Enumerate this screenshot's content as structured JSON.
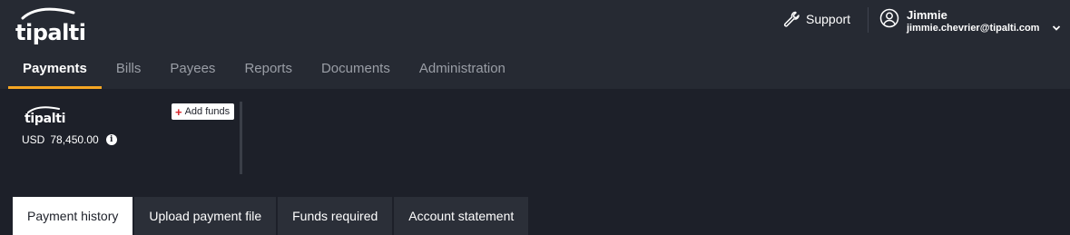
{
  "brand": {
    "logo_text": "tipalti",
    "accent_color": "#f5a623",
    "plus_color": "#d9262c"
  },
  "header": {
    "support_label": "Support",
    "support_icon": "wrench-icon",
    "user": {
      "name": "Jimmie",
      "email": "jimmie.chevrier@tipalti.com",
      "avatar_icon": "user-circle-icon",
      "menu_icon": "chevron-down-icon"
    }
  },
  "nav": {
    "items": [
      {
        "label": "Payments",
        "active": true
      },
      {
        "label": "Bills"
      },
      {
        "label": "Payees"
      },
      {
        "label": "Reports"
      },
      {
        "label": "Documents"
      },
      {
        "label": "Administration"
      }
    ]
  },
  "balance": {
    "account_logo": "tipalti",
    "currency": "USD",
    "amount": "78,450.00",
    "info_icon": "info-icon",
    "add_funds_label": "Add funds"
  },
  "tabs": [
    {
      "label": "Payment history",
      "active": true
    },
    {
      "label": "Upload payment file"
    },
    {
      "label": "Funds required"
    },
    {
      "label": "Account statement"
    }
  ]
}
